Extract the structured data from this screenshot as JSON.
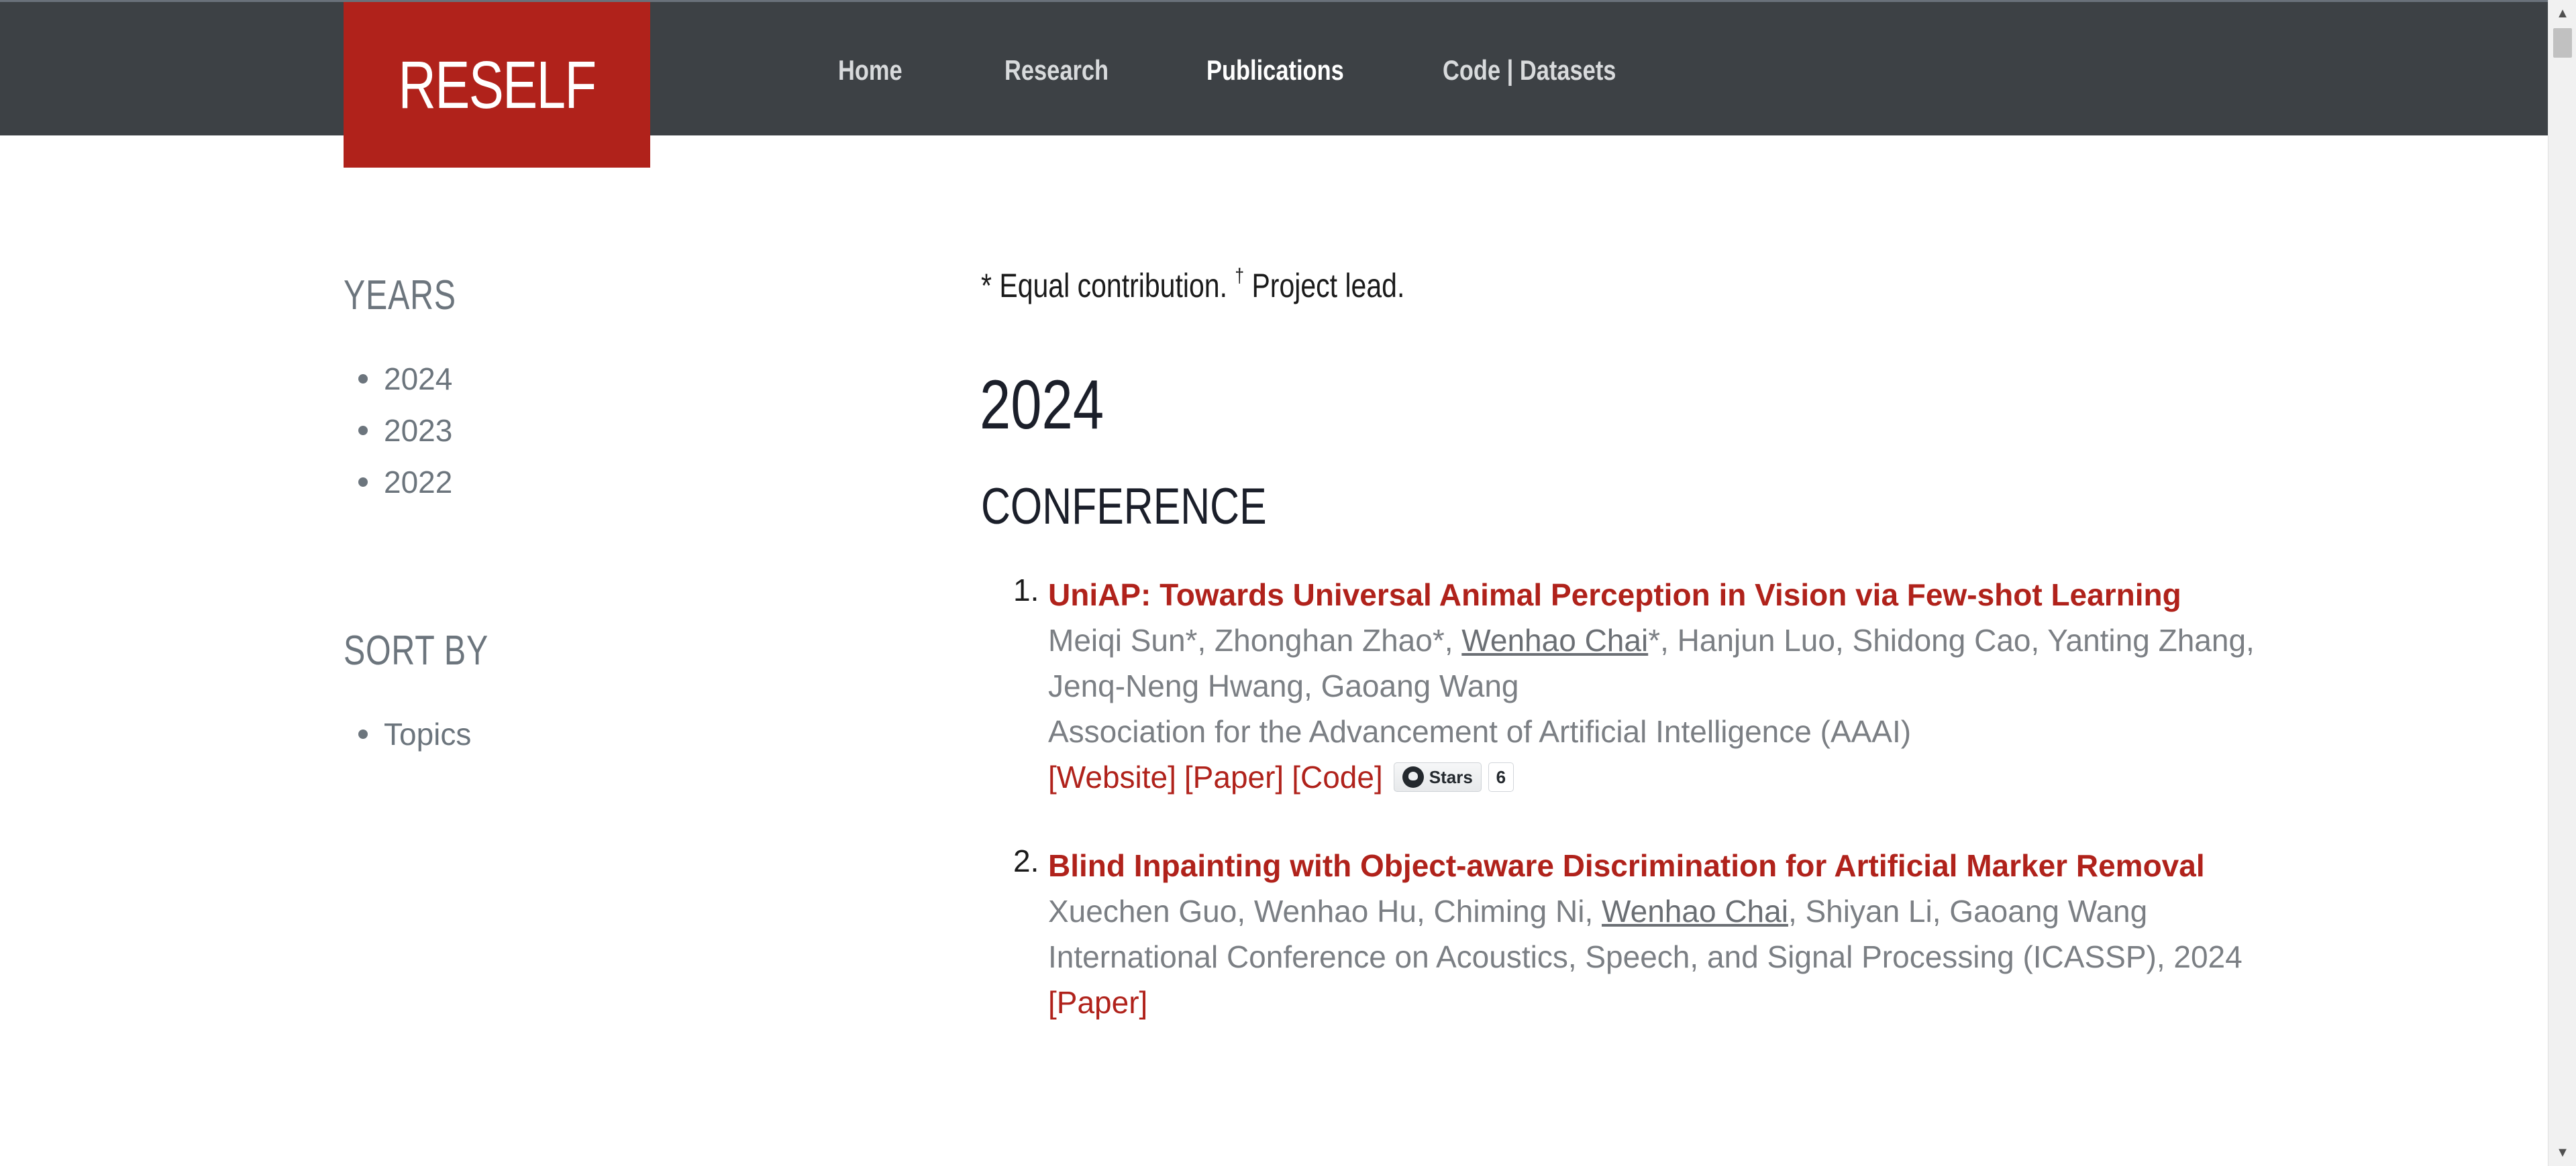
{
  "header": {
    "logo": "RESELF",
    "nav": [
      {
        "label": "Home",
        "active": false
      },
      {
        "label": "Research",
        "active": false
      },
      {
        "label": "Publications",
        "active": true
      },
      {
        "label": "Code | Datasets",
        "active": false
      }
    ]
  },
  "sidebar": {
    "years_heading": "YEARS",
    "years": [
      "2024",
      "2023",
      "2022"
    ],
    "sort_heading": "SORT BY",
    "sort_options": [
      "Topics"
    ]
  },
  "main": {
    "note_prefix": "* Equal contribution.",
    "note_dagger": "†",
    "note_suffix": "Project lead.",
    "year": "2024",
    "section": "CONFERENCE",
    "publications": [
      {
        "num": "1.",
        "title": "UniAP: Towards Universal Animal Perception in Vision via Few-shot Learning",
        "authors_before": "Meiqi Sun*, Zhonghan Zhao*, ",
        "author_me": "Wenhao Chai",
        "authors_after": "*, Hanjun Luo, Shidong Cao, Yanting Zhang,",
        "authors_line2": "Jenq-Neng Hwang, Gaoang Wang",
        "venue": "Association for the Advancement of Artificial Intelligence (AAAI)",
        "links": [
          "[Website]",
          "[Paper]",
          "[Code]"
        ],
        "github_label": "Stars",
        "github_count": "6"
      },
      {
        "num": "2.",
        "title": "Blind Inpainting with Object-aware Discrimination for Artificial Marker Removal",
        "authors_before": "Xuechen Guo, Wenhao Hu, Chiming Ni, ",
        "author_me": "Wenhao Chai",
        "authors_after": ", Shiyan Li, Gaoang Wang",
        "venue": "International Conference on Acoustics, Speech, and Signal Processing (ICASSP), 2024",
        "links": [
          "[Paper]"
        ]
      }
    ]
  },
  "colors": {
    "brand_red": "#b0221b",
    "header_bg": "#3d4145",
    "muted_text": "#7b7f84"
  }
}
